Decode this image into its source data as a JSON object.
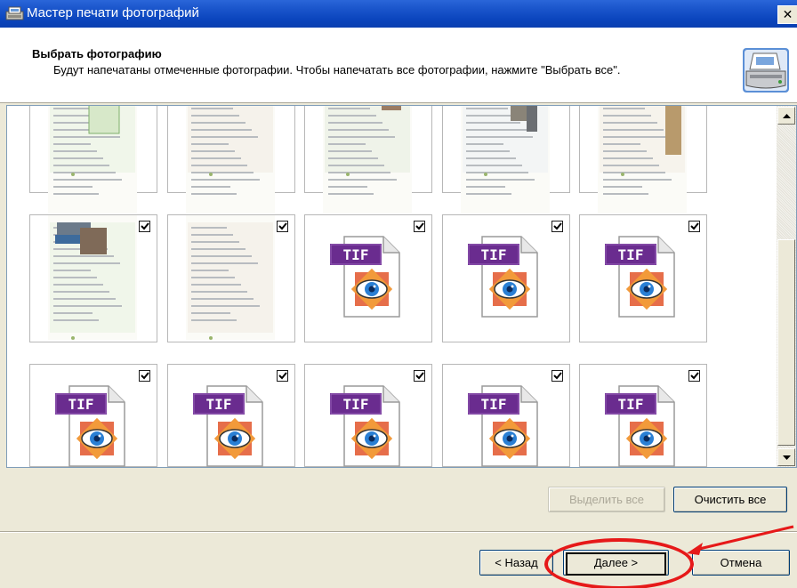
{
  "window": {
    "title": "Мастер печати фотографий",
    "close_label": "✕"
  },
  "header": {
    "title": "Выбрать фотографию",
    "description": "Будут напечатаны отмеченные фотографии. Чтобы напечатать все фотографии, нажмите \"Выбрать все\"."
  },
  "thumbnails": {
    "rows": [
      {
        "items": [
          {
            "type": "page",
            "checked": null
          },
          {
            "type": "page",
            "checked": null
          },
          {
            "type": "page",
            "checked": null
          },
          {
            "type": "page",
            "checked": null
          },
          {
            "type": "page",
            "checked": null
          }
        ]
      },
      {
        "items": [
          {
            "type": "page",
            "checked": true
          },
          {
            "type": "page",
            "checked": true
          },
          {
            "type": "tif",
            "checked": true
          },
          {
            "type": "tif",
            "checked": true
          },
          {
            "type": "tif",
            "checked": true
          }
        ]
      },
      {
        "items": [
          {
            "type": "tif",
            "checked": true
          },
          {
            "type": "tif",
            "checked": true
          },
          {
            "type": "tif",
            "checked": true
          },
          {
            "type": "tif",
            "checked": true
          },
          {
            "type": "tif",
            "checked": true
          }
        ]
      }
    ],
    "tif_label": "TIF",
    "checkmark": "✓"
  },
  "buttons": {
    "select_all": "Выделить все",
    "clear_all": "Очистить все",
    "back": "< Назад",
    "next": "Далее >",
    "cancel": "Отмена"
  }
}
